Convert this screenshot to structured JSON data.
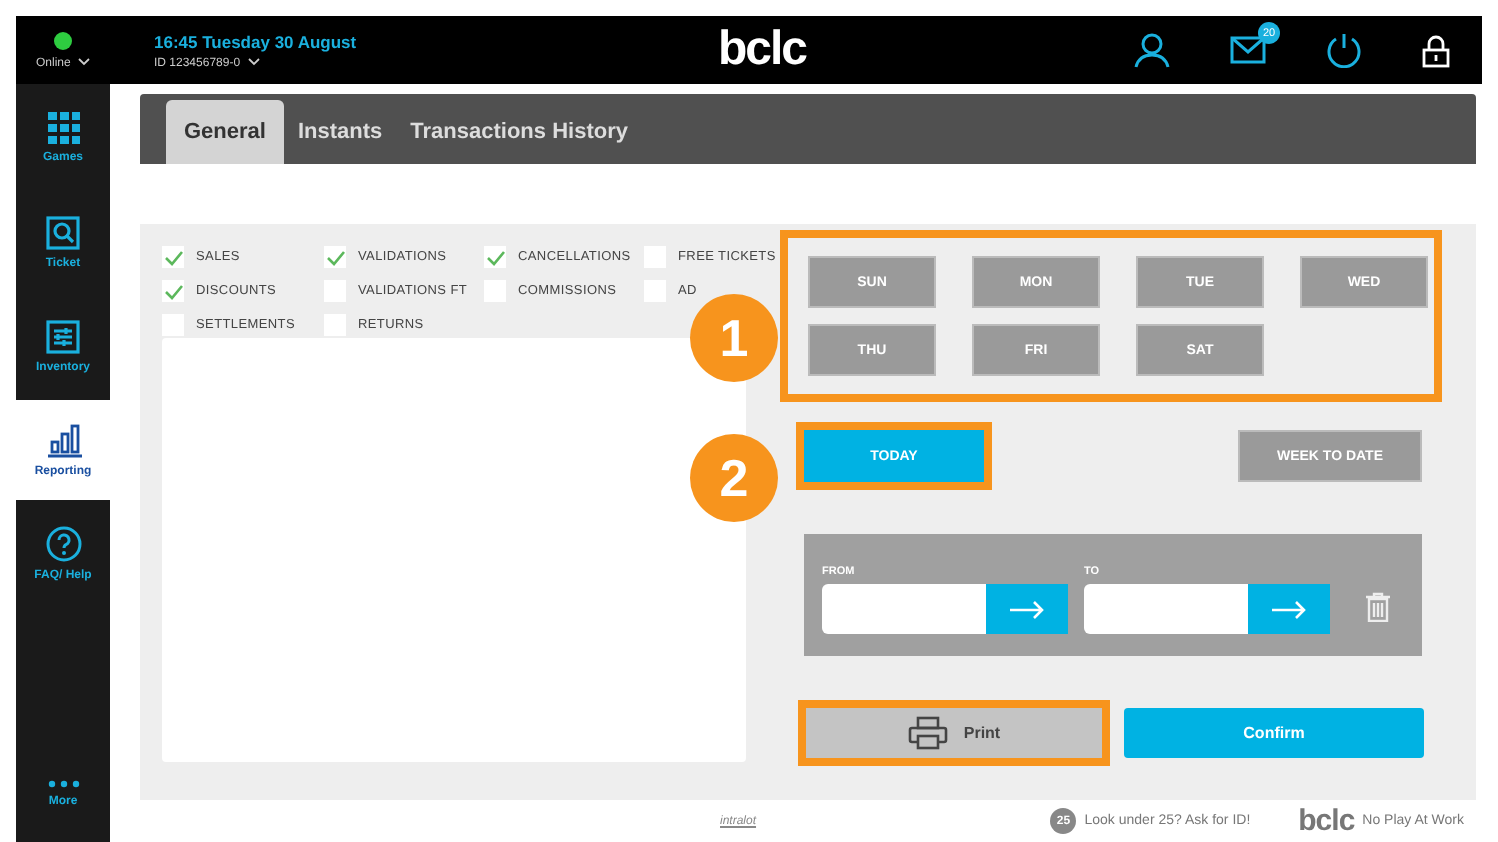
{
  "status": {
    "label": "Online",
    "online": true
  },
  "header": {
    "datetime": "16:45 Tuesday 30 August",
    "terminal_id": "ID 123456789-0",
    "logo": "bclc",
    "mail_count": "20"
  },
  "sidebar": {
    "items": [
      {
        "label": "Games",
        "selected": false
      },
      {
        "label": "Ticket",
        "selected": false
      },
      {
        "label": "Inventory",
        "selected": false
      },
      {
        "label": "Reporting",
        "selected": true
      },
      {
        "label": "FAQ/ Help",
        "selected": false
      }
    ],
    "more": "More"
  },
  "tabs": [
    {
      "label": "General",
      "selected": true
    },
    {
      "label": "Instants",
      "selected": false
    },
    {
      "label": "Transactions History",
      "selected": false
    }
  ],
  "filters": [
    {
      "label": "SALES",
      "checked": true
    },
    {
      "label": "VALIDATIONS",
      "checked": true
    },
    {
      "label": "CANCELLATIONS",
      "checked": true
    },
    {
      "label": "FREE TICKETS",
      "checked": false
    },
    {
      "label": "DISCOUNTS",
      "checked": true
    },
    {
      "label": "VALIDATIONS FT",
      "checked": false
    },
    {
      "label": "COMMISSIONS",
      "checked": false
    },
    {
      "label": "AD",
      "checked": false
    },
    {
      "label": "SETTLEMENTS",
      "checked": false
    },
    {
      "label": "RETURNS",
      "checked": false
    }
  ],
  "days": {
    "highlighted": true,
    "items": [
      "SUN",
      "MON",
      "TUE",
      "WED",
      "THU",
      "FRI",
      "SAT"
    ]
  },
  "today": {
    "label": "TODAY",
    "highlighted": true
  },
  "week_to_date": "WEEK TO DATE",
  "range": {
    "from_label": "FROM",
    "to_label": "TO"
  },
  "print": {
    "label": "Print",
    "highlighted": true
  },
  "confirm": "Confirm",
  "callouts": [
    "1",
    "2"
  ],
  "footer": {
    "vendor": "intralot",
    "age_badge": "25",
    "age_notice": "Look under 25? Ask for ID!",
    "logo": "bclc",
    "slogan": "No Play At Work"
  }
}
